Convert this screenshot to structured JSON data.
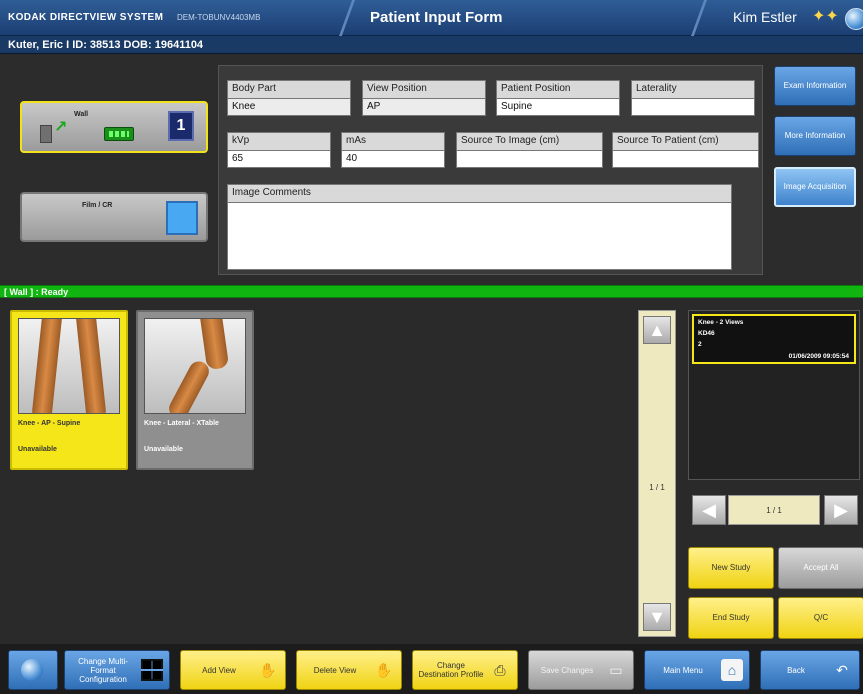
{
  "app": {
    "brand": "KODAK DIRECTVIEW SYSTEM",
    "device_id": "DEM-TOBUNV4403MB",
    "form_title": "Patient Input Form",
    "user_name": "Kim Estler"
  },
  "patient": {
    "info": "Kuter, Eric I   ID: 38513   DOB: 19641104"
  },
  "detectors": {
    "wall_label": "Wall",
    "wall_number": "1",
    "film_label": "Film / CR"
  },
  "form": {
    "body_part_label": "Body Part",
    "body_part_value": "Knee",
    "view_position_label": "View Position",
    "view_position_value": "AP",
    "patient_position_label": "Patient Position",
    "patient_position_value": "Supine",
    "laterality_label": "Laterality",
    "laterality_value": "",
    "kvp_label": "kVp",
    "kvp_value": "65",
    "mas_label": "mAs",
    "mas_value": "40",
    "sid_label": "Source To Image (cm)",
    "sid_value": "",
    "sod_label": "Source To Patient (cm)",
    "sod_value": "",
    "comments_label": "Image Comments",
    "comments_value": ""
  },
  "side_tabs": [
    {
      "label": "Exam Information"
    },
    {
      "label": "More Information"
    },
    {
      "label": "Image Acquisition"
    }
  ],
  "status": {
    "text": "[ Wall ] : Ready"
  },
  "thumbnails": [
    {
      "title": "Knee - AP - Supine",
      "status": "Unavailable"
    },
    {
      "title": "Knee - Lateral - XTable",
      "status": "Unavailable"
    }
  ],
  "scroll": {
    "page": "1 / 1"
  },
  "study": {
    "title": "Knee - 2 Views",
    "code": "KD46",
    "count": "2",
    "date": "01/06/2009 09:05:54",
    "page": "1 / 1"
  },
  "actions": {
    "new_study": "New Study",
    "accept_all": "Accept All",
    "end_study": "End Study",
    "qc": "Q/C"
  },
  "toolbar": {
    "change_mf": "Change Multi-Format Configuration",
    "add_view": "Add View",
    "delete_view": "Delete View",
    "change_dest": "Change Destination Profile",
    "save_changes": "Save Changes",
    "main_menu": "Main Menu",
    "back": "Back"
  },
  "colors": {
    "header_blue": "#1c3f73",
    "status_green": "#10b510",
    "highlight_yellow": "#f5e61a",
    "button_blue": "#2f6fb6"
  },
  "icons": [
    "stars-icon",
    "globe-icon",
    "wall-detector-icon",
    "battery-icon",
    "film-cassette-icon",
    "up-arrow-icon",
    "down-arrow-icon",
    "left-arrow-icon",
    "right-arrow-icon",
    "hand-add-icon",
    "hand-delete-icon",
    "printer-icon",
    "save-icon",
    "home-icon",
    "back-arrow-icon",
    "multi-format-grid-icon"
  ]
}
